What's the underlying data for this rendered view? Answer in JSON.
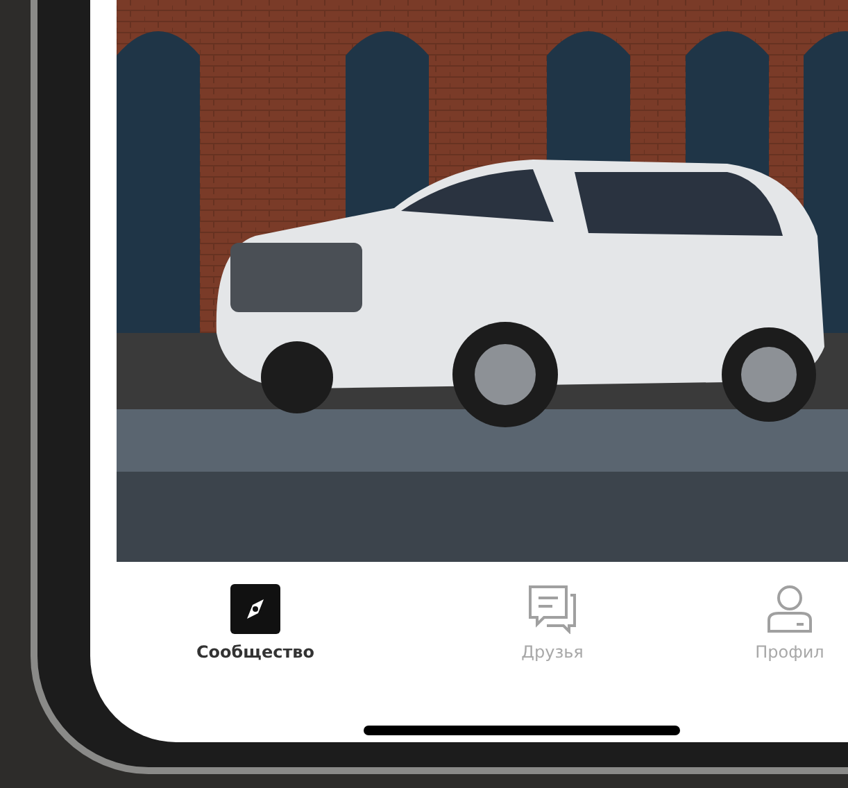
{
  "tab_bar": {
    "tabs": [
      {
        "label": "Сообщество",
        "selected": true
      },
      {
        "label": "Друзья",
        "selected": false
      },
      {
        "label": "Профил",
        "selected": false
      }
    ]
  }
}
